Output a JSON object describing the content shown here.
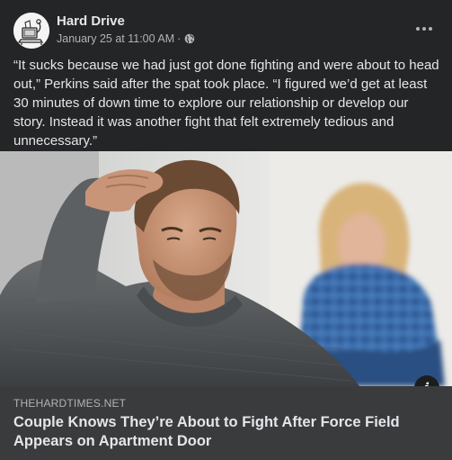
{
  "post": {
    "page_name": "Hard Drive",
    "timestamp": "January 25 at 11:00 AM",
    "separator": "·",
    "privacy_icon": "globe-icon",
    "more_icon": "more-horizontal-icon",
    "body_text": "“It sucks because we had just got done fighting and were about to head out,” Perkins said after the spat took place. “I figured we’d get at least 30 minutes of down time to explore our relationship or develop our story. Instead it was another fight that felt extremely tedious and unnecessary.”"
  },
  "link_preview": {
    "domain": "THEHARDTIMES.NET",
    "headline": "Couple Knows They’re About to Fight After Force Field Appears on Apartment Door",
    "info_label": "i",
    "info_icon": "info-icon"
  },
  "colors": {
    "background": "#242526",
    "card_footer": "#3a3b3c",
    "primary_text": "#e4e6eb",
    "secondary_text": "#b0b3b8"
  }
}
